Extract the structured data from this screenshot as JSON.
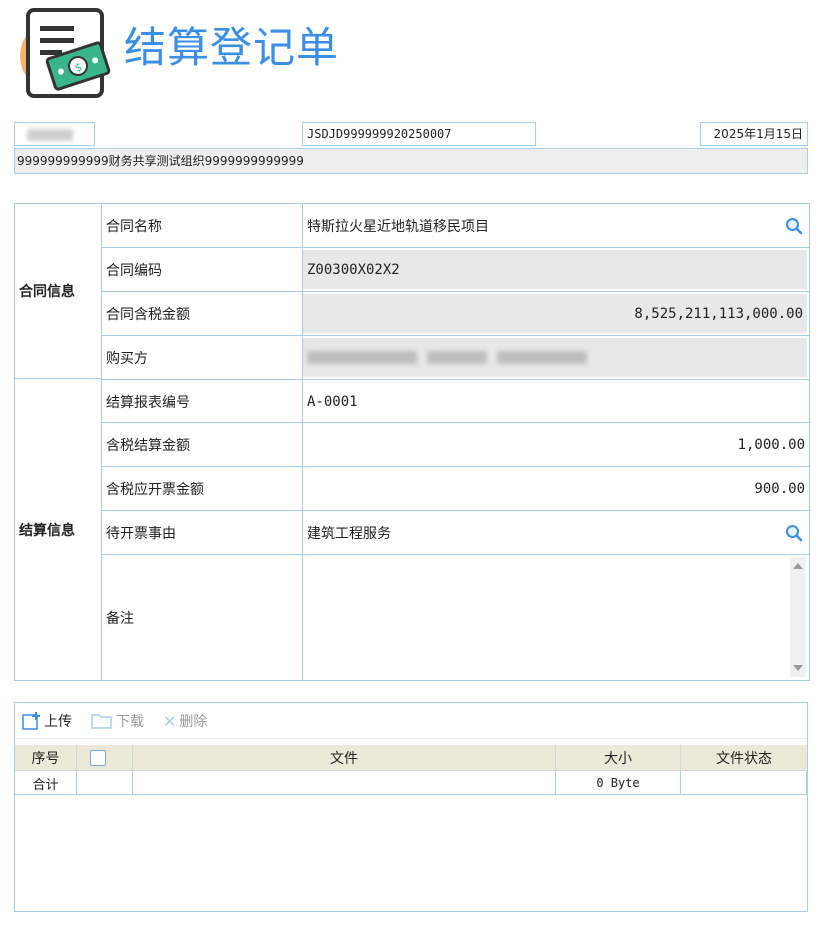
{
  "header": {
    "title": "结算登记单",
    "logo_icon": "document-money-icon"
  },
  "top_fields": {
    "left_value": "",
    "doc_number": "JSDJD999999920250007",
    "date": "2025年1月15日",
    "org": "999999999999财务共享测试组织9999999999999"
  },
  "sections": {
    "contract": "合同信息",
    "settlement": "结算信息"
  },
  "contract": {
    "name_label": "合同名称",
    "name_value": "特斯拉火星近地轨道移民项目",
    "code_label": "合同编码",
    "code_value": "Z00300X02X2",
    "amount_label": "合同含税金额",
    "amount_value": "8,525,211,113,000.00",
    "buyer_label": "购买方",
    "buyer_value": ""
  },
  "settlement": {
    "report_no_label": "结算报表编号",
    "report_no_value": "A-0001",
    "amount_label": "含税结算金额",
    "amount_value": "1,000.00",
    "invoice_amount_label": "含税应开票金额",
    "invoice_amount_value": "900.00",
    "reason_label": "待开票事由",
    "reason_value": "建筑工程服务",
    "remark_label": "备注",
    "remark_value": ""
  },
  "attachments": {
    "upload": "上传",
    "download": "下载",
    "delete": "删除",
    "columns": {
      "index": "序号",
      "file": "文件",
      "size": "大小",
      "status": "文件状态"
    },
    "total_label": "合计",
    "total_size": "0 Byte"
  },
  "colors": {
    "accent": "#3a8ee6",
    "border": "#a9cfe6",
    "readonly": "#e8e8e8",
    "table_header": "#ece9d8"
  }
}
